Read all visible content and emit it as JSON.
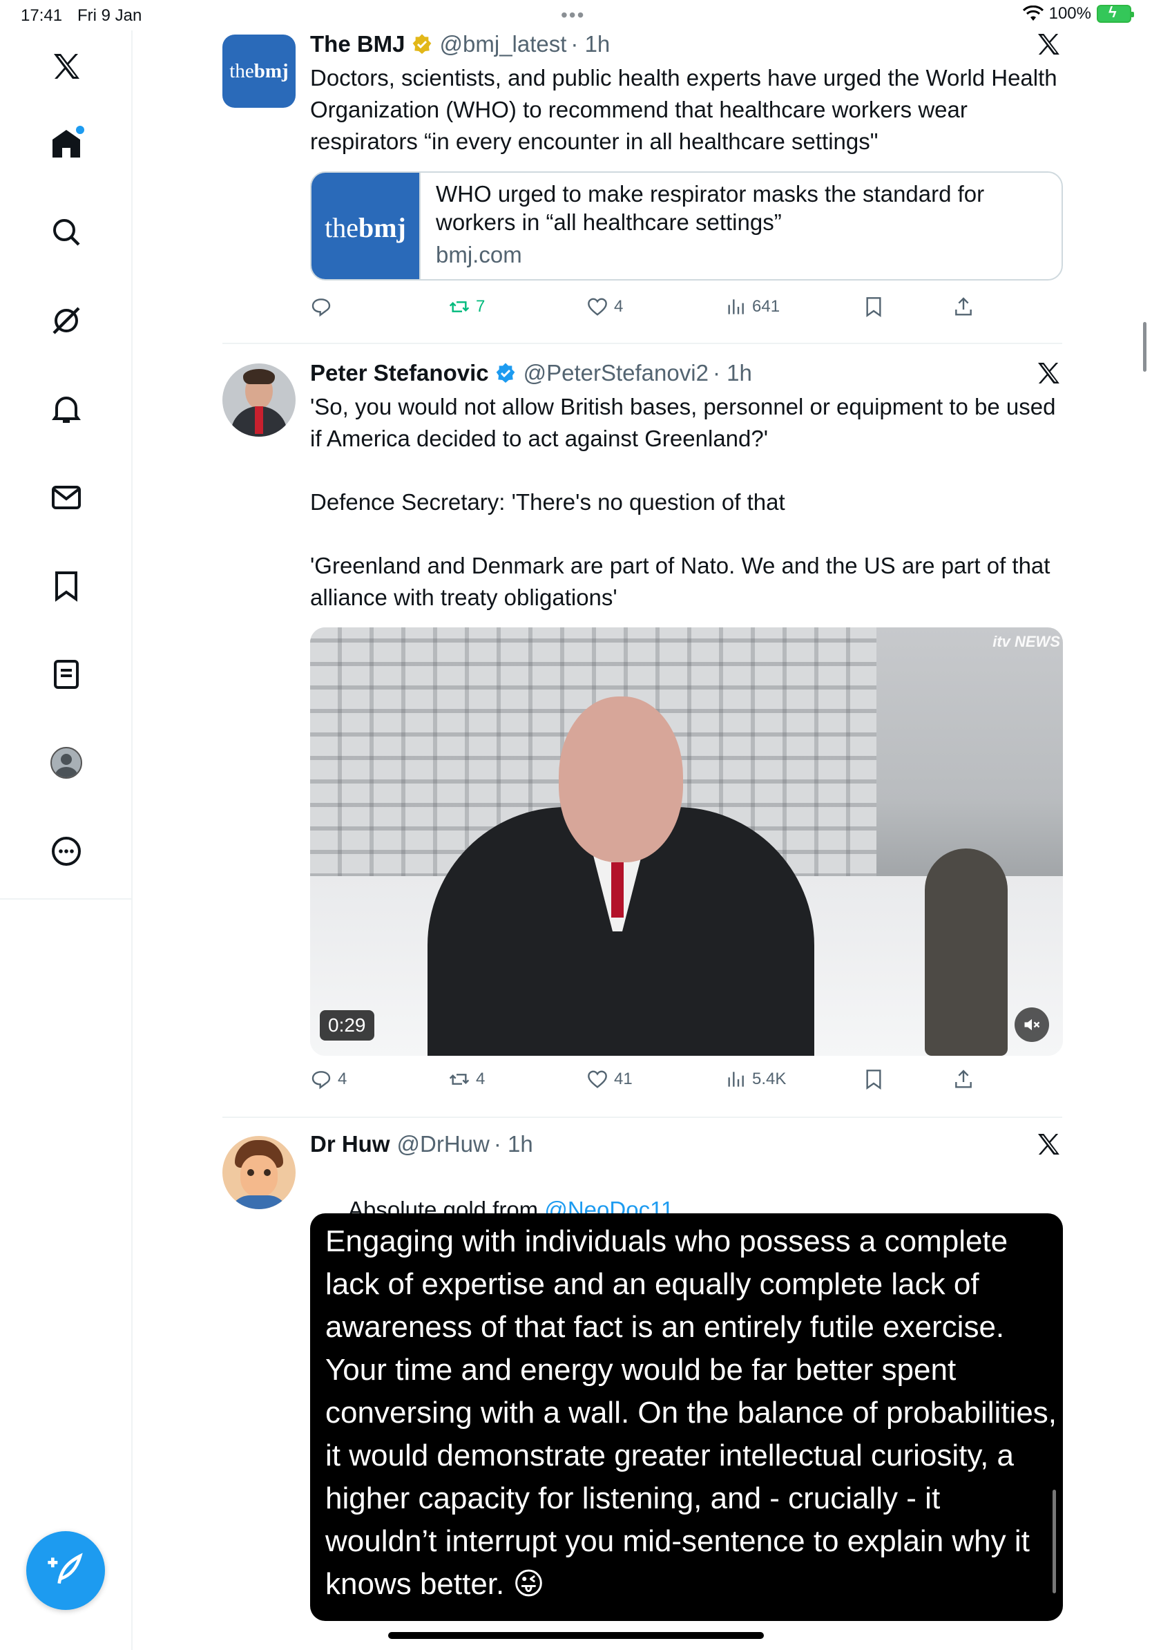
{
  "status_bar": {
    "time": "17:41",
    "date": "Fri 9 Jan",
    "battery": "100%"
  },
  "colors": {
    "accent": "#1d9bf0",
    "text": "#0f1419",
    "secondary": "#536471",
    "retweet_active": "#00ba7c",
    "bmj_blue": "#2a6ab9",
    "verified_gold": "#e2b719"
  },
  "sidebar": {
    "items": [
      {
        "icon": "x-logo-icon"
      },
      {
        "icon": "home-icon"
      },
      {
        "icon": "search-icon"
      },
      {
        "icon": "grok-icon"
      },
      {
        "icon": "bell-icon"
      },
      {
        "icon": "mail-icon"
      },
      {
        "icon": "bookmark-icon"
      },
      {
        "icon": "lists-icon"
      },
      {
        "icon": "profile-icon"
      },
      {
        "icon": "more-icon"
      }
    ],
    "compose_icon": "compose-icon"
  },
  "tweets": [
    {
      "avatar_text_light": "the",
      "avatar_text_bold": "bmj",
      "name": "The BMJ",
      "verified": "gold",
      "handle": "@bmj_latest",
      "time": "· 1h",
      "text": "Doctors, scientists, and public health experts have urged the World Health Organization (WHO) to recommend that healthcare workers wear respirators “in every encounter in all healthcare settings\"",
      "card": {
        "thumb_light": "the",
        "thumb_bold": "bmj",
        "title": "WHO urged to make respirator masks the standard for workers in “all healthcare settings”",
        "domain": "bmj.com"
      },
      "actions": {
        "replies": "",
        "retweets": "7",
        "likes": "4",
        "views": "641"
      }
    },
    {
      "name": "Peter Stefanovic",
      "verified": "blue",
      "handle": "@PeterStefanovi2",
      "time": "· 1h",
      "text": "'So, you would not allow British bases, personnel or equipment to be used if America decided to act against Greenland?'\n\nDefence Secretary: 'There's no question of that\n\n'Greenland and Denmark are part of Nato. We and the US are part of that alliance with treaty obligations'",
      "video": {
        "duration": "0:29",
        "watermark": "itv NEWS"
      },
      "actions": {
        "replies": "4",
        "retweets": "4",
        "likes": "41",
        "views": "5.4K"
      }
    },
    {
      "name": "Dr Huw",
      "handle": "@DrHuw",
      "time": "· 1h",
      "text_prefix": "Absolute gold from ",
      "mention": "@NeoDoc11",
      "image_text": "Engaging with individuals who possess a complete lack of expertise and an equally complete lack of awareness of that fact is an entirely futile exercise. Your time and energy would be far better spent conversing with a wall. On the balance of probabilities, it would demonstrate greater intellectual curiosity, a higher capacity for listening, and - crucially - it wouldn’t interrupt you mid-sentence to explain why it knows better. 😜"
    }
  ]
}
